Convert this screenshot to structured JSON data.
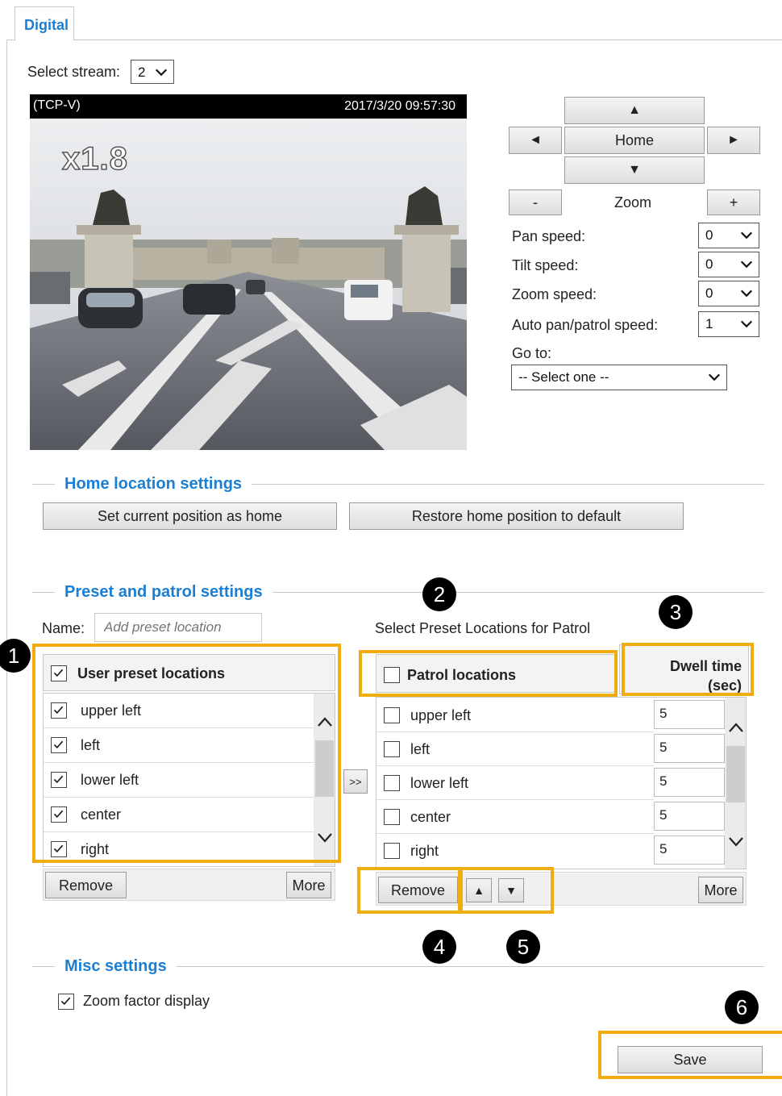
{
  "tab": {
    "label": "Digital"
  },
  "stream": {
    "label": "Select stream:",
    "value": "2"
  },
  "video": {
    "protocol": "(TCP-V)",
    "timestamp": "2017/3/20 09:57:30",
    "zoom_factor": "x1.8"
  },
  "ptz": {
    "up": "▲",
    "down": "▼",
    "left": "◄",
    "right": "►",
    "home": "Home",
    "zoom_out": "-",
    "zoom_label": "Zoom",
    "zoom_in": "+",
    "pan_speed_label": "Pan speed:",
    "pan_speed_value": "0",
    "tilt_speed_label": "Tilt speed:",
    "tilt_speed_value": "0",
    "zoom_speed_label": "Zoom speed:",
    "zoom_speed_value": "0",
    "auto_pan_label": "Auto pan/patrol speed:",
    "auto_pan_value": "1",
    "goto_label": "Go to:",
    "goto_value": "-- Select one --"
  },
  "home_settings": {
    "title": "Home location settings",
    "set_home": "Set current position as home",
    "restore_home": "Restore home position to default"
  },
  "preset": {
    "title": "Preset and patrol settings",
    "name_label": "Name:",
    "name_placeholder": "Add preset location",
    "patrol_caption": "Select Preset Locations for Patrol",
    "user_header": "User preset locations",
    "user_items": [
      {
        "label": "upper left",
        "checked": true
      },
      {
        "label": "left",
        "checked": true
      },
      {
        "label": "lower left",
        "checked": true
      },
      {
        "label": "center",
        "checked": true
      },
      {
        "label": "right",
        "checked": true
      }
    ],
    "transfer": ">>",
    "patrol_header": "Patrol locations",
    "dwell_header_1": "Dwell time",
    "dwell_header_2": "(sec)",
    "patrol_items": [
      {
        "label": "upper left",
        "dwell": "5"
      },
      {
        "label": "left",
        "dwell": "5"
      },
      {
        "label": "lower left",
        "dwell": "5"
      },
      {
        "label": "center",
        "dwell": "5"
      },
      {
        "label": "right",
        "dwell": "5"
      }
    ],
    "remove": "Remove",
    "more": "More",
    "move_up": "▲",
    "move_down": "▼"
  },
  "misc": {
    "title": "Misc settings",
    "zoom_display": "Zoom factor display"
  },
  "save": "Save",
  "badges": [
    "1",
    "2",
    "3",
    "4",
    "5",
    "6"
  ],
  "colors": {
    "accent": "#1a7fd4",
    "highlight": "#f0ad0f"
  }
}
